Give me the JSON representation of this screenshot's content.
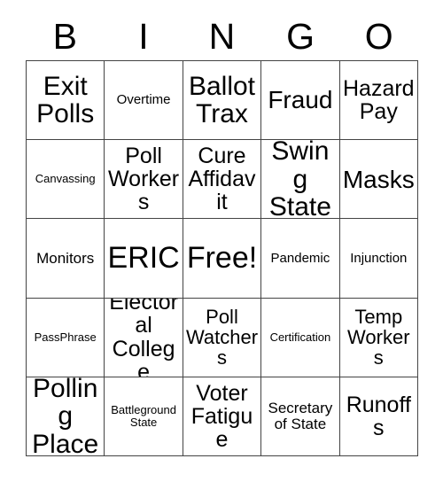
{
  "card": {
    "title": "BINGO",
    "header_letters": [
      "B",
      "I",
      "N",
      "G",
      "O"
    ],
    "colors": {
      "background": "#ffffff",
      "text": "#000000",
      "grid_line": "#444444"
    },
    "grid": {
      "rows": 5,
      "columns": 5,
      "free_space_label": "Free!",
      "free_space_position": "r3c3"
    },
    "squares": [
      {
        "id": "r1c1",
        "column": "B",
        "row": 1,
        "label": "Exit\nPolls",
        "size": "lg"
      },
      {
        "id": "r1c2",
        "column": "I",
        "row": 1,
        "label": "Overtime",
        "size": "xxs"
      },
      {
        "id": "r1c3",
        "column": "N",
        "row": 1,
        "label": "Ballot\nTrax",
        "size": "lg"
      },
      {
        "id": "r1c4",
        "column": "G",
        "row": 1,
        "label": "Fraud",
        "size": "ml"
      },
      {
        "id": "r1c5",
        "column": "O",
        "row": 1,
        "label": "Hazard\nPay",
        "size": "md"
      },
      {
        "id": "r2c1",
        "column": "B",
        "row": 2,
        "label": "Canvassing",
        "size": "tiny"
      },
      {
        "id": "r2c2",
        "column": "I",
        "row": 2,
        "label": "Poll\nWorkers",
        "size": "md"
      },
      {
        "id": "r2c3",
        "column": "N",
        "row": 2,
        "label": "Cure\nAffidavit",
        "size": "md"
      },
      {
        "id": "r2c4",
        "column": "G",
        "row": 2,
        "label": "Swing\nState",
        "size": "lg"
      },
      {
        "id": "r2c5",
        "column": "O",
        "row": 2,
        "label": "Masks",
        "size": "ml"
      },
      {
        "id": "r3c1",
        "column": "B",
        "row": 3,
        "label": "Monitors",
        "size": "xs"
      },
      {
        "id": "r3c2",
        "column": "I",
        "row": 3,
        "label": "ERIC",
        "size": "xl"
      },
      {
        "id": "r3c3",
        "column": "N",
        "row": 3,
        "label": "Free!",
        "size": "xl"
      },
      {
        "id": "r3c4",
        "column": "G",
        "row": 3,
        "label": "Pandemic",
        "size": "xxs"
      },
      {
        "id": "r3c5",
        "column": "O",
        "row": 3,
        "label": "Injunction",
        "size": "xxs"
      },
      {
        "id": "r4c1",
        "column": "B",
        "row": 4,
        "label": "PassPhrase",
        "size": "tiny"
      },
      {
        "id": "r4c2",
        "column": "I",
        "row": 4,
        "label": "Electoral\nCollege",
        "size": "md"
      },
      {
        "id": "r4c3",
        "column": "N",
        "row": 4,
        "label": "Poll\nWatchers",
        "size": "sm"
      },
      {
        "id": "r4c4",
        "column": "G",
        "row": 4,
        "label": "Certification",
        "size": "tiny"
      },
      {
        "id": "r4c5",
        "column": "O",
        "row": 4,
        "label": "Temp\nWorkers",
        "size": "sm"
      },
      {
        "id": "r5c1",
        "column": "B",
        "row": 5,
        "label": "Polling\nPlace",
        "size": "lg"
      },
      {
        "id": "r5c2",
        "column": "I",
        "row": 5,
        "label": "Battleground\nState",
        "size": "tiny"
      },
      {
        "id": "r5c3",
        "column": "N",
        "row": 5,
        "label": "Voter\nFatigue",
        "size": "md"
      },
      {
        "id": "r5c4",
        "column": "G",
        "row": 5,
        "label": "Secretary\nof State",
        "size": "xs"
      },
      {
        "id": "r5c5",
        "column": "O",
        "row": 5,
        "label": "Runoffs",
        "size": "md"
      }
    ]
  }
}
